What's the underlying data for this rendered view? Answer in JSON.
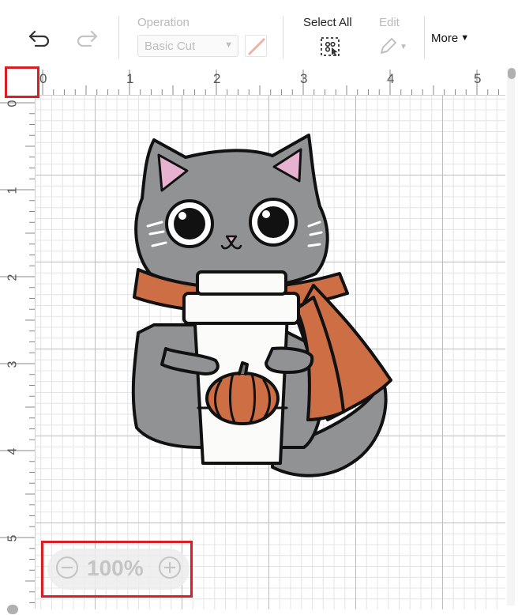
{
  "toolbar": {
    "undo_icon": "undo-icon",
    "redo_icon": "redo-icon",
    "operation_label": "Operation",
    "operation_value": "Basic Cut",
    "select_all_label": "Select All",
    "edit_label": "Edit",
    "more_label": "More"
  },
  "ruler": {
    "top_numbers": [
      "0",
      "1",
      "2",
      "3",
      "4",
      "5"
    ],
    "left_numbers": [
      "0",
      "1",
      "2",
      "3",
      "4",
      "5"
    ]
  },
  "zoom": {
    "value": "100%"
  },
  "colors": {
    "highlight": "#d81f26",
    "cat_gray": "#909294",
    "scarf_orange": "#cd6e44",
    "ear_pink": "#e7b2cf",
    "cup_white": "#fbfbf9"
  }
}
